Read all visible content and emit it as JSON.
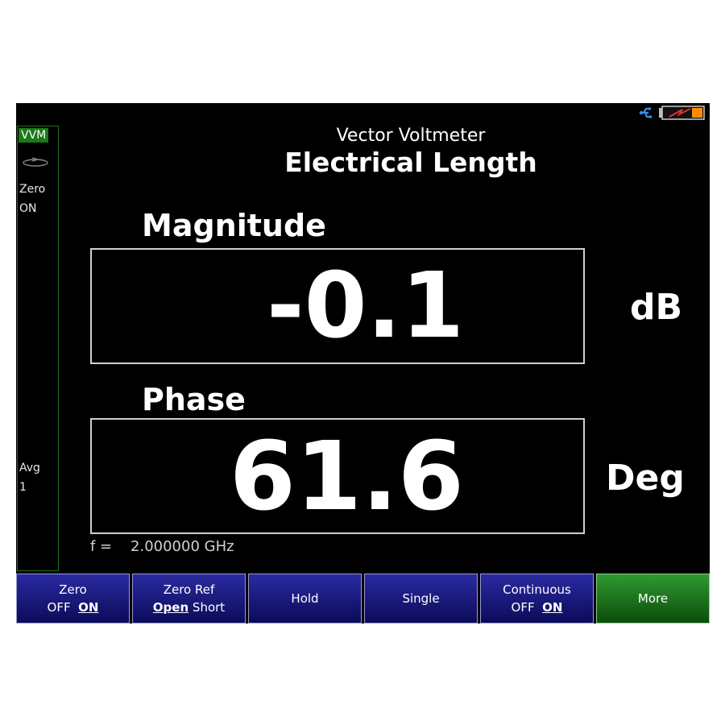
{
  "header": {
    "title_main": "Vector Voltmeter",
    "title_sub": "Electrical Length"
  },
  "status_icons": {
    "usb": "usb-icon",
    "battery": "battery-icon",
    "battery_color": "#ff8c00"
  },
  "left_panel": {
    "mode": "VVM",
    "zero_label": "Zero",
    "zero_value": "ON",
    "avg_label": "Avg",
    "avg_value": "1"
  },
  "magnitude": {
    "label": "Magnitude",
    "value": "-0.1",
    "unit": "dB"
  },
  "phase": {
    "label": "Phase",
    "value": "61.6",
    "unit": "Deg"
  },
  "frequency": {
    "prefix": "f =",
    "value": "2.000000 GHz"
  },
  "softkeys": [
    {
      "line1": "Zero",
      "off": "OFF",
      "on": "ON"
    },
    {
      "line1": "Zero Ref",
      "open": "Open",
      "short": "Short"
    },
    {
      "label": "Hold"
    },
    {
      "label": "Single"
    },
    {
      "line1": "Continuous",
      "off": "OFF",
      "on": "ON"
    },
    {
      "label": "More"
    }
  ],
  "colors": {
    "softkey_blue": "#1a1a80",
    "softkey_green": "#1e7a1e",
    "mode_badge": "#1a7a1a"
  }
}
